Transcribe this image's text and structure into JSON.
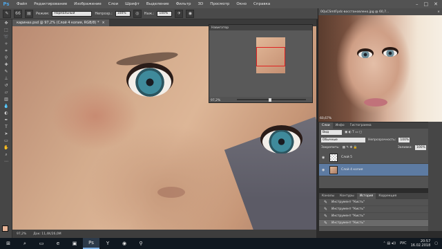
{
  "menubar": {
    "logo": "Ps",
    "items": [
      "Файл",
      "Редактирование",
      "Изображение",
      "Слои",
      "Шрифт",
      "Выделение",
      "Фильтр",
      "3D",
      "Просмотр",
      "Окно",
      "Справка"
    ],
    "controls": [
      "–",
      "□",
      "✕"
    ]
  },
  "options": {
    "brush_size": "66",
    "mode_label": "Режим:",
    "mode_value": "Нормальный",
    "opacity_label": "Непрозр.:",
    "opacity_value": "100%",
    "flow_label": "Наж.:",
    "flow_value": "100%"
  },
  "document": {
    "tab_label": "кариназ.psd @ 97,2% (Слой 4 копия, RGB/8) *",
    "close": "×",
    "status_zoom": "97,2%",
    "status_doc": "Док: 11,4K/26,0M"
  },
  "navigator": {
    "title": "Навигатор",
    "zoom": "97,2%"
  },
  "reference": {
    "title": "0QuCSmtFpdc-восстановлено.jpg @ 60,7...",
    "close": "×",
    "zoom": "60,67%"
  },
  "layers_panel": {
    "tabs": [
      "Слои",
      "Инфо",
      "Гистограмма"
    ],
    "kind_value": "Вид",
    "blend_value": "Обычные",
    "opacity_label": "Непрозрачность:",
    "opacity_value": "100%",
    "lock_label": "Закрепить:",
    "fill_label": "Заливка:",
    "fill_value": "100%",
    "layers": [
      {
        "name": "Слой 5",
        "selected": false
      },
      {
        "name": "Слой 4 копия",
        "selected": true
      }
    ]
  },
  "history_panel": {
    "tabs": [
      "Каналы",
      "Контуры",
      "История",
      "Коррекция"
    ],
    "active_tab": "История",
    "items": [
      "Инструмент \"Кисть\"",
      "Инструмент \"Кисть\"",
      "Инструмент \"Кисть\"",
      "Инструмент \"Кисть\""
    ]
  },
  "taskbar": {
    "items": [
      "⊞",
      "⌕",
      "▭",
      "e",
      "▣",
      "Ps",
      "Y",
      "◉",
      "⚲"
    ],
    "active_index": 5,
    "lang": "РУС",
    "time": "20:57",
    "date": "16.02.2018"
  },
  "colors": {
    "foreground": "#e8b497",
    "background": "#ffffff",
    "selected_layer": "#5d7ba2"
  }
}
